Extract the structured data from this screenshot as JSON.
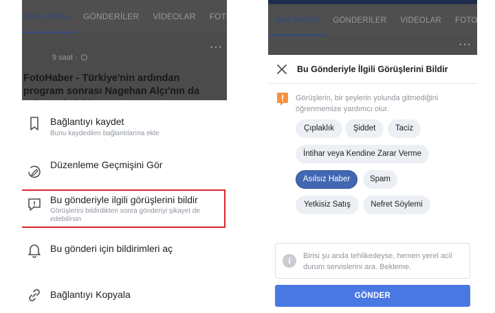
{
  "left": {
    "tabs": [
      "ANA SAYFA",
      "GÖNDERİLER",
      "VİDEOLAR",
      "FOTOĞ"
    ],
    "post": {
      "time": "9 saat",
      "text": "FotoHaber - Türkiye'nin ardından program sonrası Nagehan Alçı'nın da nabzına bakıldı..."
    },
    "menu": [
      {
        "title": "Bağlantıyı kaydet",
        "subtitle": "Bunu kaydedilen bağlantılarına ekle",
        "icon": "bookmark-icon"
      },
      {
        "title": "Düzenleme Geçmişini Gör",
        "subtitle": "",
        "icon": "edit-history-icon"
      },
      {
        "title": "Bu gönderiyle ilgili görüşlerini bildir",
        "subtitle": "Görüşlerini bildirdikten sonra gönderiyi şikayet de edebilirsin",
        "icon": "feedback-icon"
      },
      {
        "title": "Bu gönderi için bildirimleri aç",
        "subtitle": "",
        "icon": "bell-icon"
      },
      {
        "title": "Bağlantıyı Kopyala",
        "subtitle": "",
        "icon": "link-icon"
      }
    ],
    "highlight_color": "#d9242b"
  },
  "right": {
    "tabs": [
      "ANA SAYFA",
      "GÖNDERİLER",
      "VİDEOLAR",
      "FOTOĞR"
    ],
    "dialog": {
      "title": "Bu Gönderiyle İlgili Görüşlerini Bildir",
      "description": "Görüşlerin, bir şeylerin yolunda gitmediğini öğrenmemize yardımcı olur.",
      "chips": [
        "Çıplaklık",
        "Şiddet",
        "Taciz",
        "İntihar veya Kendine Zarar Verme",
        "Asılsız Haber",
        "Spam",
        "Yetkisiz Satış",
        "Nefret Söylemi"
      ],
      "selected_chip": "Asılsız Haber",
      "info_text": "Birisi şu anda tehlikedeyse, hemen yerel acil durum servislerini ara. Bekleme.",
      "send_label": "GÖNDER"
    },
    "accent_color": "#4267b2",
    "button_color": "#4a78e3"
  }
}
